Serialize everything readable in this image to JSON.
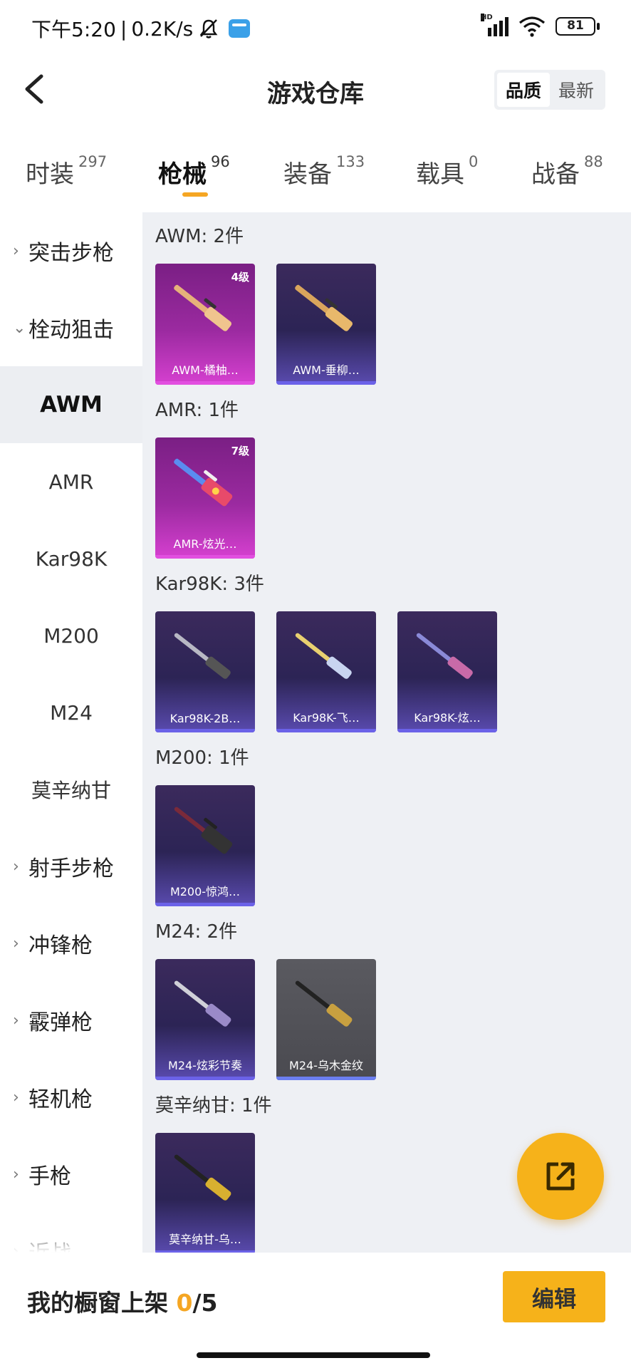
{
  "status_bar": {
    "time": "下午5:20",
    "speed": "0.2K/s",
    "signal_label": "HD",
    "battery": "81"
  },
  "header": {
    "title": "游戏仓库",
    "sort_quality": "品质",
    "sort_latest": "最新"
  },
  "tabs": [
    {
      "label": "时装",
      "count": "297"
    },
    {
      "label": "枪械",
      "count": "96"
    },
    {
      "label": "装备",
      "count": "133"
    },
    {
      "label": "载具",
      "count": "0"
    },
    {
      "label": "战备",
      "count": "88"
    }
  ],
  "sidebar": {
    "items": [
      {
        "label": "突击步枪"
      },
      {
        "label": "栓动狙击"
      },
      {
        "label": "AWM"
      },
      {
        "label": "AMR"
      },
      {
        "label": "Kar98K"
      },
      {
        "label": "M200"
      },
      {
        "label": "M24"
      },
      {
        "label": "莫辛纳甘"
      },
      {
        "label": "射手步枪"
      },
      {
        "label": "冲锋枪"
      },
      {
        "label": "霰弹枪"
      },
      {
        "label": "轻机枪"
      },
      {
        "label": "手枪"
      },
      {
        "label": "近战"
      }
    ]
  },
  "sections": [
    {
      "title": "AWM: 2件",
      "cards": [
        {
          "name": "AWM-橘柚…",
          "level": "4级",
          "style": "pink"
        },
        {
          "name": "AWM-垂柳…",
          "level": "",
          "style": "purple"
        }
      ]
    },
    {
      "title": "AMR: 1件",
      "cards": [
        {
          "name": "AMR-炫光…",
          "level": "7级",
          "style": "pink"
        }
      ]
    },
    {
      "title": "Kar98K: 3件",
      "cards": [
        {
          "name": "Kar98K-2B…",
          "level": "",
          "style": "purple"
        },
        {
          "name": "Kar98K-飞…",
          "level": "",
          "style": "purple"
        },
        {
          "name": "Kar98K-炫…",
          "level": "",
          "style": "purple"
        }
      ]
    },
    {
      "title": "M200: 1件",
      "cards": [
        {
          "name": "M200-惊鸿…",
          "level": "",
          "style": "purple"
        }
      ]
    },
    {
      "title": "M24: 2件",
      "cards": [
        {
          "name": "M24-炫彩节奏",
          "level": "",
          "style": "purple"
        },
        {
          "name": "M24-乌木金纹",
          "level": "",
          "style": "gray"
        }
      ]
    },
    {
      "title": "莫辛纳甘: 1件",
      "cards": [
        {
          "name": "莫辛纳甘-乌…",
          "level": "",
          "style": "purple"
        }
      ]
    }
  ],
  "bottom": {
    "label": "我的橱窗上架",
    "current": "0",
    "total": "/5",
    "edit": "编辑"
  },
  "icons": {
    "back": "back-arrow-icon",
    "share": "share-external-icon",
    "chevron_right": "chevron-right-icon",
    "chevron_down": "chevron-down-icon"
  },
  "colors": {
    "accent": "#f6b21a",
    "underline": "#f5a623",
    "rarity_purple": "#6b62e8",
    "rarity_pink": "#e24fe0"
  }
}
